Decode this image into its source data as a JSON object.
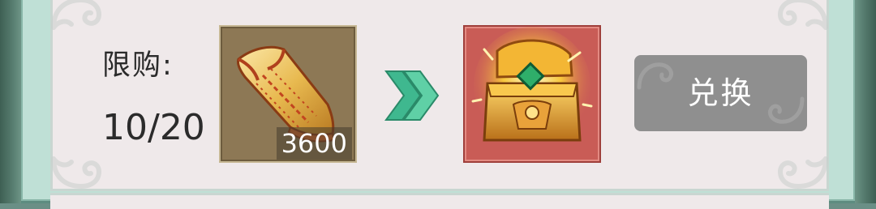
{
  "purchase_limit": {
    "label": "限购:",
    "count": "10/20",
    "current": 10,
    "max": 20
  },
  "cost_item": {
    "icon": "scroll-icon",
    "quantity": "3600"
  },
  "reward_item": {
    "icon": "golden-treasure-chest-icon"
  },
  "exchange_button": {
    "label": "兑换",
    "state": "disabled"
  },
  "colors": {
    "panel_bg": "#efe9ea",
    "frame_teal": "#bfe0d6",
    "cost_slot_bg": "#8d7855",
    "reward_slot_bg": "#c95c56",
    "arrow_green": "#3fb88f",
    "button_gray": "#8f8f8f"
  }
}
